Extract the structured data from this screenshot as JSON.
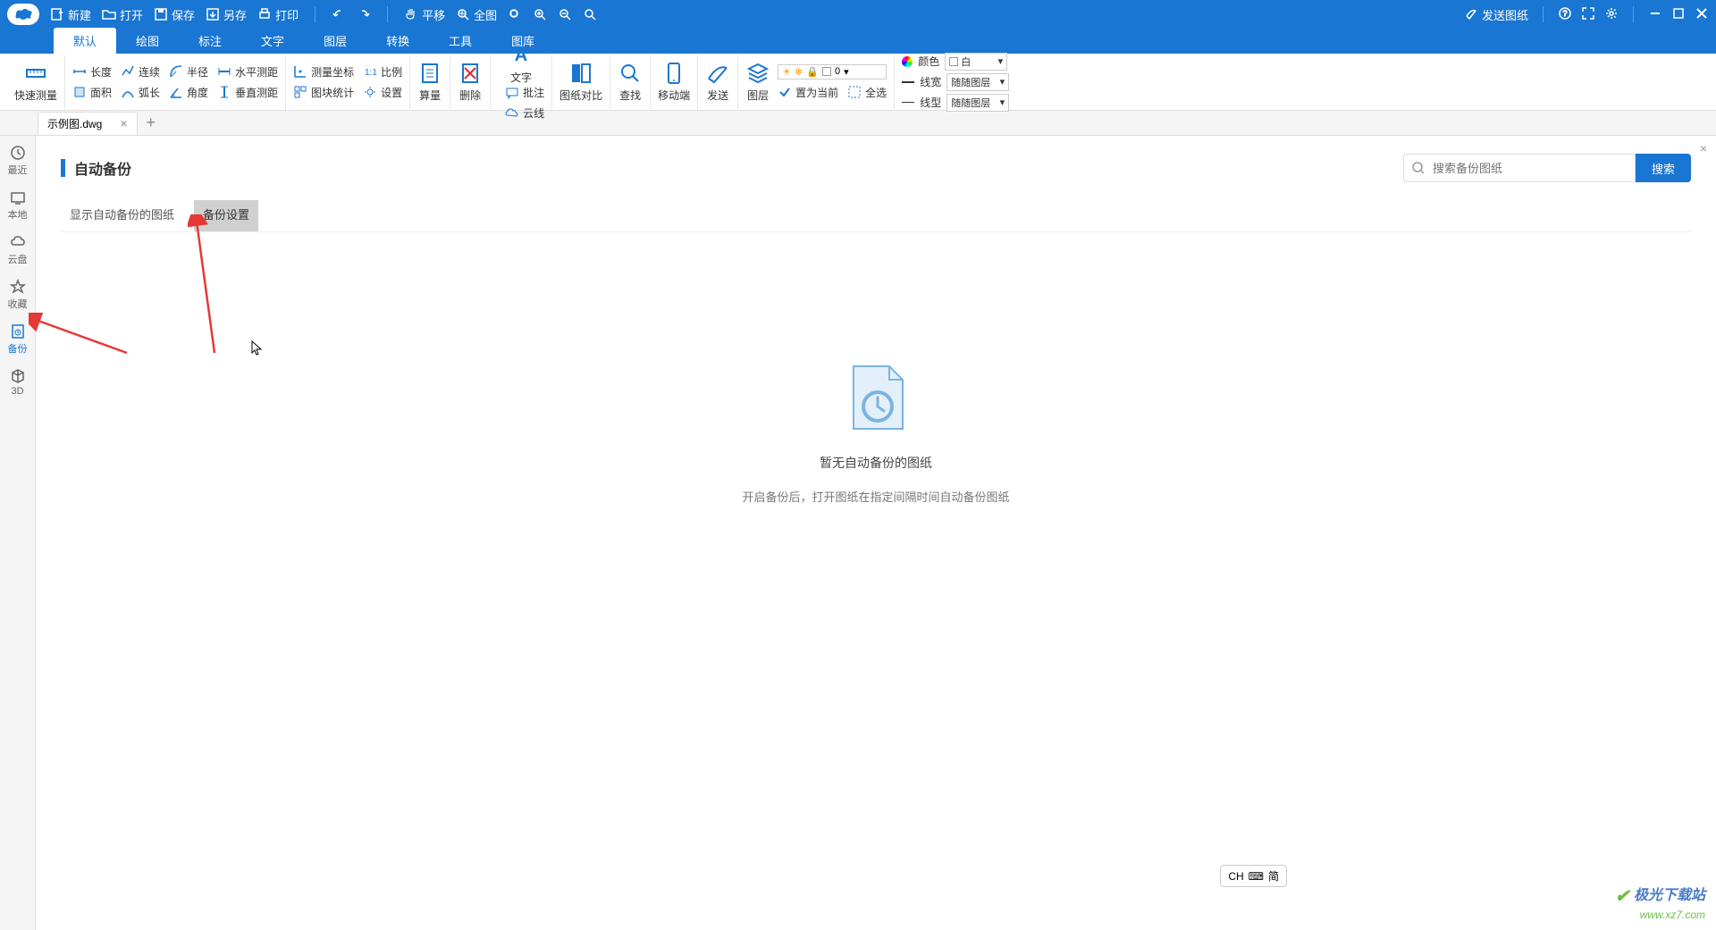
{
  "titlebar": {
    "new": "新建",
    "open": "打开",
    "save": "保存",
    "saveas": "另存",
    "print": "打印",
    "pan": "平移",
    "fullview": "全图",
    "send_drawing": "发送图纸"
  },
  "menutabs": [
    "默认",
    "绘图",
    "标注",
    "文字",
    "图层",
    "转换",
    "工具",
    "图库"
  ],
  "ribbon": {
    "quick_measure": "快速测量",
    "length": "长度",
    "continuous": "连续",
    "radius": "半径",
    "hdist": "水平测距",
    "area": "面积",
    "arc": "弧长",
    "angle": "角度",
    "vdist": "垂直测距",
    "coord": "测量坐标",
    "scale": "比例",
    "blockstat": "图块统计",
    "settings": "设置",
    "sum": "算量",
    "delete": "删除",
    "text": "文字",
    "batch": "批注",
    "cloud": "云线",
    "compare": "图纸对比",
    "find": "查找",
    "mobile": "移动端",
    "send": "发送",
    "layer": "图层",
    "setcurrent": "置为当前",
    "selectall": "全选",
    "sunval": "0",
    "color": "颜色",
    "color_val": "白",
    "lwidth": "线宽",
    "lwidth_val": "随随图层",
    "ltype": "线型",
    "ltype_val": "随随图层"
  },
  "filetab": {
    "name": "示例图.dwg"
  },
  "sidebar": {
    "recent": "最近",
    "local": "本地",
    "cloud": "云盘",
    "favorite": "收藏",
    "backup": "备份",
    "threed": "3D"
  },
  "page": {
    "title": "自动备份",
    "tab1": "显示自动备份的图纸",
    "tab2": "备份设置",
    "search_placeholder": "搜索备份图纸",
    "search_btn": "搜索",
    "empty_title": "暂无自动备份的图纸",
    "empty_sub": "开启备份后，打开图纸在指定间隔时间自动备份图纸"
  },
  "ime": {
    "lang": "CH",
    "mode": "简"
  },
  "watermark": {
    "line1": "极光下载站",
    "line2": "www.xz7.com"
  }
}
